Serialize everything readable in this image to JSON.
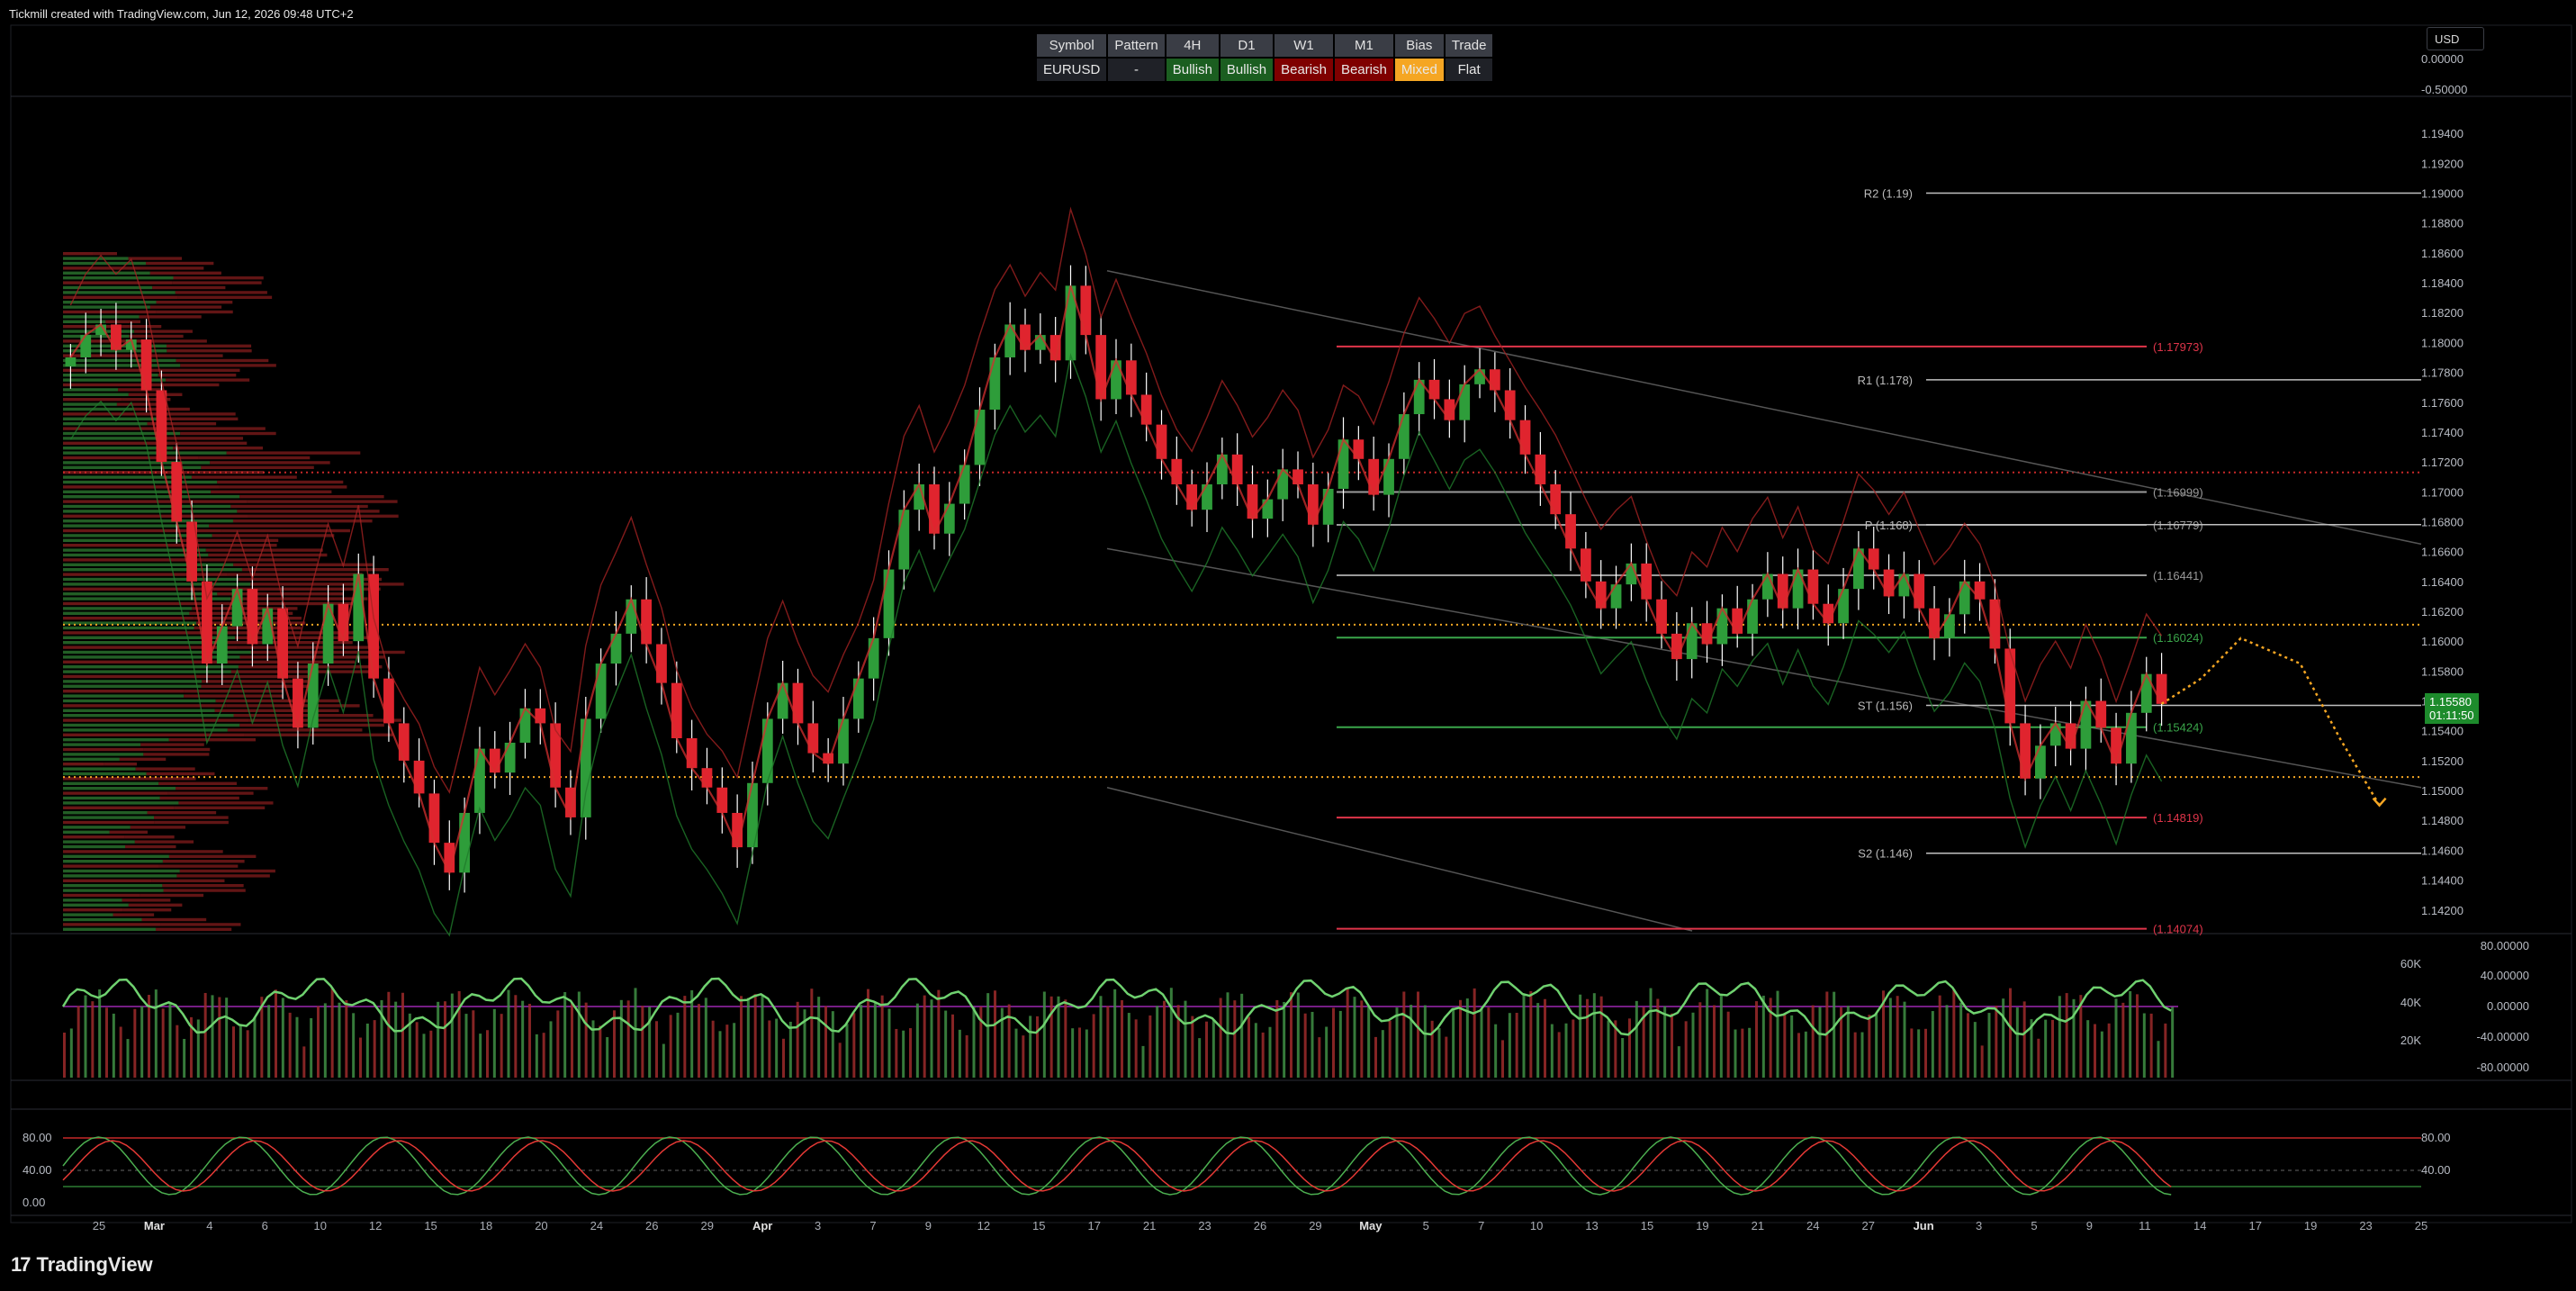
{
  "header": {
    "title": "Tickmill created with TradingView.com, Jun 12, 2026 09:48 UTC+2"
  },
  "currency": "USD",
  "signal_table": {
    "headers": [
      "Symbol",
      "Pattern",
      "4H",
      "D1",
      "W1",
      "M1",
      "Bias",
      "Trade"
    ],
    "values": [
      "EURUSD",
      "-",
      "Bullish",
      "Bullish",
      "Bearish",
      "Bearish",
      "Mixed",
      "Flat"
    ],
    "colors": [
      "#1f2127",
      "#1f2127",
      "#1b5e20",
      "#1b5e20",
      "#7f0000",
      "#7f0000",
      "#f5a623",
      "#1f2127"
    ]
  },
  "brand": {
    "logo": "17",
    "name": "TradingView"
  },
  "price_badge": {
    "price": "1.15580",
    "countdown": "01:11:50"
  },
  "top_axis": [
    "0.00000",
    "-0.50000"
  ],
  "osc_axis": [
    "80.00000",
    "40.00000",
    "0.00000",
    "-40.00000",
    "-80.00000"
  ],
  "vol_axis": [
    "60K",
    "40K",
    "20K"
  ],
  "stoch_axis_left": [
    "80.00",
    "40.00",
    "0.00"
  ],
  "stoch_axis_right": [
    "80.00",
    "40.00"
  ],
  "levels": [
    {
      "label": "R2 (1.19)",
      "price": 1.19,
      "color": "#bbbbbb"
    },
    {
      "label": "R1 (1.178)",
      "price": 1.1775,
      "color": "#bbbbbb"
    },
    {
      "label": "P (1.168)",
      "price": 1.1678,
      "color": "#bbbbbb"
    },
    {
      "label": "ST (1.156)",
      "price": 1.1557,
      "color": "#bbbbbb"
    },
    {
      "label": "S2 (1.146)",
      "price": 1.1458,
      "color": "#bbbbbb"
    }
  ],
  "zones": [
    {
      "label": "(1.17973)",
      "price": 1.17973,
      "color": "#e0354a"
    },
    {
      "label": "(1.16999)",
      "price": 1.16999,
      "color": "#9a9a9a"
    },
    {
      "label": "(1.16779)",
      "price": 1.16779,
      "color": "#9a9a9a"
    },
    {
      "label": "(1.16441)",
      "price": 1.16441,
      "color": "#9a9a9a"
    },
    {
      "label": "(1.16024)",
      "price": 1.16024,
      "color": "#3aa64a"
    },
    {
      "label": "(1.15424)",
      "price": 1.15424,
      "color": "#3aa64a"
    },
    {
      "label": "(1.14819)",
      "price": 1.14819,
      "color": "#e0354a"
    },
    {
      "label": "(1.14074)",
      "price": 1.14074,
      "color": "#e0354a"
    }
  ],
  "chart_data": {
    "type": "candlestick",
    "symbol": "EURUSD",
    "y_ticks": [
      1.194,
      1.192,
      1.19,
      1.188,
      1.186,
      1.184,
      1.182,
      1.18,
      1.178,
      1.176,
      1.174,
      1.172,
      1.17,
      1.168,
      1.166,
      1.164,
      1.162,
      1.16,
      1.158,
      1.156,
      1.154,
      1.152,
      1.15,
      1.148,
      1.146,
      1.144,
      1.142
    ],
    "y_tick_labels": [
      "1.19400",
      "1.19200",
      "1.19000",
      "1.18800",
      "1.18600",
      "1.18400",
      "1.18200",
      "1.18000",
      "1.17800",
      "1.17600",
      "1.17400",
      "1.17200",
      "1.17000",
      "1.16800",
      "1.16600",
      "1.16400",
      "1.16200",
      "1.16000",
      "1.15800",
      "1.15600",
      "1.15400",
      "1.15200",
      "1.15000",
      "1.14800",
      "1.14600",
      "1.14400",
      "1.14200"
    ],
    "ylim": [
      1.1406,
      1.1963
    ],
    "x_tick_labels": [
      "25",
      "Mar",
      "4",
      "6",
      "10",
      "12",
      "15",
      "18",
      "20",
      "24",
      "26",
      "29",
      "Apr",
      "3",
      "7",
      "9",
      "12",
      "15",
      "17",
      "21",
      "23",
      "26",
      "29",
      "May",
      "5",
      "7",
      "10",
      "13",
      "15",
      "19",
      "21",
      "24",
      "27",
      "Jun",
      "3",
      "5",
      "9",
      "11",
      "14",
      "17",
      "19",
      "23",
      "25"
    ],
    "x_bold": [
      "Mar",
      "Apr",
      "May",
      "Jun"
    ],
    "closes": [
      1.179,
      1.1805,
      1.1812,
      1.1795,
      1.1802,
      1.1768,
      1.172,
      1.168,
      1.164,
      1.1585,
      1.161,
      1.1635,
      1.1598,
      1.1622,
      1.1575,
      1.1542,
      1.1585,
      1.1625,
      1.16,
      1.1645,
      1.1575,
      1.1545,
      1.152,
      1.1498,
      1.1465,
      1.1445,
      1.1485,
      1.1528,
      1.1512,
      1.1532,
      1.1555,
      1.1545,
      1.1502,
      1.1482,
      1.1548,
      1.1585,
      1.1605,
      1.1628,
      1.1598,
      1.1572,
      1.1535,
      1.1515,
      1.1502,
      1.1485,
      1.1462,
      1.1505,
      1.1548,
      1.1572,
      1.1545,
      1.1525,
      1.1518,
      1.1548,
      1.1575,
      1.1602,
      1.1648,
      1.1688,
      1.1705,
      1.1672,
      1.1692,
      1.1718,
      1.1755,
      1.179,
      1.1812,
      1.1795,
      1.1805,
      1.1788,
      1.1838,
      1.1805,
      1.1762,
      1.1788,
      1.1765,
      1.1745,
      1.1722,
      1.1705,
      1.1688,
      1.1705,
      1.1725,
      1.1705,
      1.1682,
      1.1695,
      1.1715,
      1.1705,
      1.1678,
      1.1702,
      1.1735,
      1.1722,
      1.1698,
      1.1722,
      1.1752,
      1.1775,
      1.1762,
      1.1748,
      1.1772,
      1.1782,
      1.1768,
      1.1748,
      1.1725,
      1.1705,
      1.1685,
      1.1662,
      1.164,
      1.1622,
      1.1638,
      1.1652,
      1.1628,
      1.1605,
      1.1588,
      1.1612,
      1.1598,
      1.1622,
      1.1605,
      1.1628,
      1.1645,
      1.1622,
      1.1648,
      1.1625,
      1.1612,
      1.1635,
      1.1662,
      1.1648,
      1.163,
      1.1645,
      1.1622,
      1.1602,
      1.1618,
      1.164,
      1.1628,
      1.1595,
      1.1545,
      1.1508,
      1.153,
      1.1545,
      1.1528,
      1.156,
      1.1542,
      1.1518,
      1.1552,
      1.1578,
      1.1558
    ],
    "forecast": [
      [
        1.1558,
        0
      ],
      [
        1.1575,
        2
      ],
      [
        1.1602,
        4
      ],
      [
        1.1585,
        7
      ],
      [
        1.1535,
        9
      ],
      [
        1.149,
        11
      ]
    ]
  }
}
